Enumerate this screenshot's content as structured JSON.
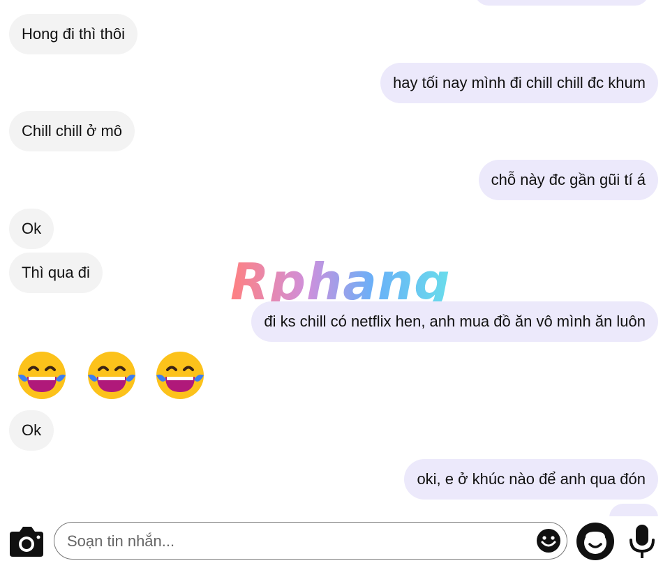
{
  "watermark": "Rphang",
  "messages": [
    {
      "side": "in",
      "text": "Hong đi thì thôi"
    },
    {
      "side": "out",
      "text": "hay tối nay mình đi chill chill đc khum"
    },
    {
      "side": "in",
      "text": "Chill chill ở mô"
    },
    {
      "side": "out",
      "text": "chỗ này đc gần gũi tí á"
    },
    {
      "side": "in",
      "text": "Ok"
    },
    {
      "side": "in",
      "text": "Thì qua đi"
    },
    {
      "side": "out",
      "text": "đi ks chill có netflix hen, anh mua đồ ăn vô mình ăn luôn"
    },
    {
      "side": "in",
      "text": "Ok"
    },
    {
      "side": "out",
      "text": "oki, e ở khúc nào để anh qua đón"
    }
  ],
  "emojis": [
    "laughing-tears",
    "laughing-tears",
    "laughing-tears"
  ],
  "composer": {
    "placeholder": "Soạn tin nhắn...",
    "value": ""
  },
  "colors": {
    "incoming_bubble": "#f3f3f3",
    "outgoing_bubble": "#ece9fb"
  },
  "icons": {
    "camera": "camera-icon",
    "emoji": "smiley-icon",
    "assistant": "chat-bot-icon",
    "mic": "microphone-icon"
  }
}
